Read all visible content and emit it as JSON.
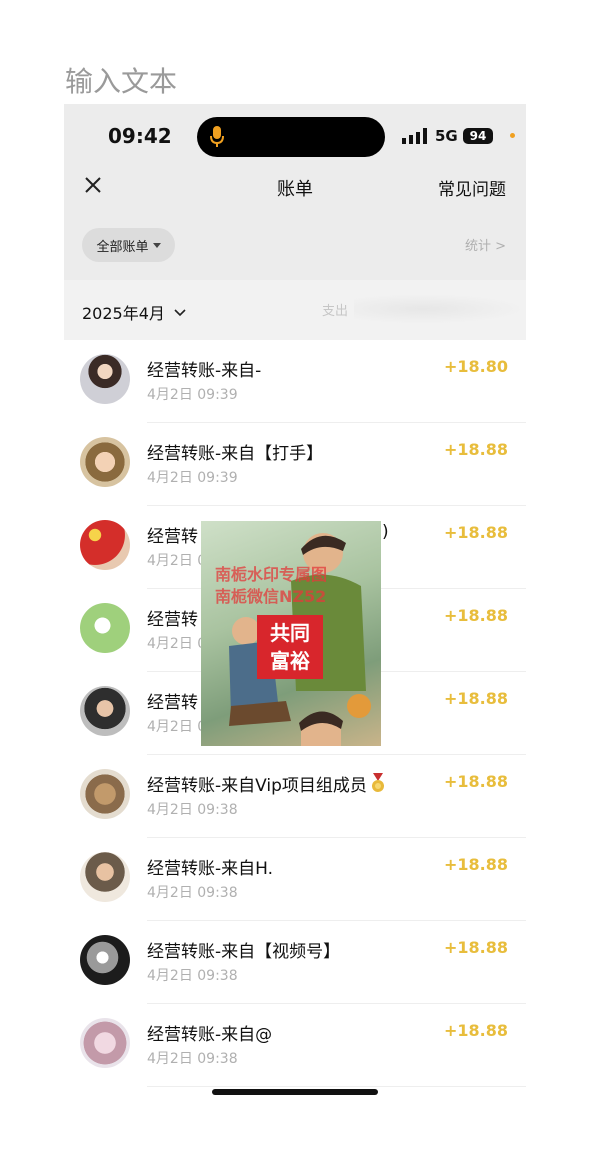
{
  "caption": "输入文本",
  "status_bar": {
    "time": "09:42",
    "network": "5G",
    "battery": "94"
  },
  "nav": {
    "title": "账单",
    "faq": "常见问题"
  },
  "filter": {
    "label": "全部账单",
    "stats": "统计 >"
  },
  "month_bar": {
    "month": "2025年4月",
    "summary": "支出"
  },
  "transactions": [
    {
      "title": "经营转账-来自-",
      "time": "4月2日 09:39",
      "amount": "+18.80"
    },
    {
      "title": "经营转账-来自【打手】",
      "time": "4月2日 09:39",
      "amount": "+18.88"
    },
    {
      "title": "经营转",
      "title_tail": ")",
      "time": "4月2日 0",
      "amount": "+18.88"
    },
    {
      "title": "经营转",
      "time": "4月2日 0",
      "amount": "+18.88"
    },
    {
      "title": "经营转",
      "time": "4月2日 0",
      "amount": "+18.88"
    },
    {
      "title": "经营转账-来自Vip项目组成员",
      "time": "4月2日 09:38",
      "amount": "+18.88"
    },
    {
      "title": "经营转账-来自H.",
      "time": "4月2日 09:38",
      "amount": "+18.88"
    },
    {
      "title": "经营转账-来自【视频号】",
      "time": "4月2日 09:38",
      "amount": "+18.88"
    },
    {
      "title": "经营转账-来自@",
      "time": "4月2日 09:38",
      "amount": "+18.88"
    }
  ],
  "overlay": {
    "watermark_line1": "南栀水印专属图",
    "watermark_line2": "南栀微信NZ52",
    "badge_line1": "共同",
    "badge_line2": "富裕"
  },
  "colors": {
    "amount": "#e8bd3c",
    "header_bg": "#ececec",
    "badge": "#d8262c"
  }
}
